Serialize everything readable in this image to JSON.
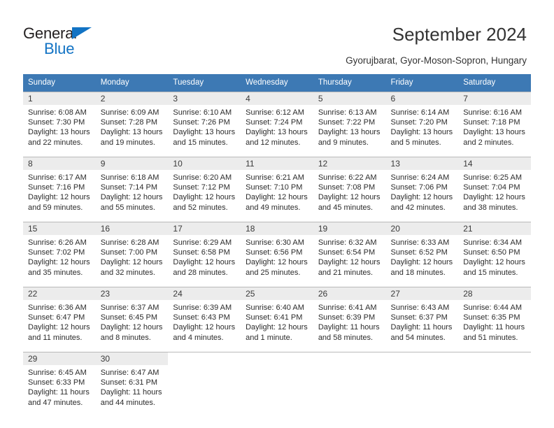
{
  "brand": {
    "name_part1": "General",
    "name_part2": "Blue",
    "logo_icon": "triangle-icon"
  },
  "header": {
    "title": "September 2024",
    "subtitle": "Gyorujbarat, Gyor-Moson-Sopron, Hungary"
  },
  "colors": {
    "header_blue": "#3d79b4",
    "brand_blue": "#1273c4",
    "day_band_gray": "#ececec",
    "grid_line": "#b9b9b9",
    "text": "#2b2b2b"
  },
  "weekday_headers": [
    "Sunday",
    "Monday",
    "Tuesday",
    "Wednesday",
    "Thursday",
    "Friday",
    "Saturday"
  ],
  "weeks": [
    [
      {
        "day": "1",
        "sunrise": "Sunrise: 6:08 AM",
        "sunset": "Sunset: 7:30 PM",
        "daylight1": "Daylight: 13 hours",
        "daylight2": "and 22 minutes."
      },
      {
        "day": "2",
        "sunrise": "Sunrise: 6:09 AM",
        "sunset": "Sunset: 7:28 PM",
        "daylight1": "Daylight: 13 hours",
        "daylight2": "and 19 minutes."
      },
      {
        "day": "3",
        "sunrise": "Sunrise: 6:10 AM",
        "sunset": "Sunset: 7:26 PM",
        "daylight1": "Daylight: 13 hours",
        "daylight2": "and 15 minutes."
      },
      {
        "day": "4",
        "sunrise": "Sunrise: 6:12 AM",
        "sunset": "Sunset: 7:24 PM",
        "daylight1": "Daylight: 13 hours",
        "daylight2": "and 12 minutes."
      },
      {
        "day": "5",
        "sunrise": "Sunrise: 6:13 AM",
        "sunset": "Sunset: 7:22 PM",
        "daylight1": "Daylight: 13 hours",
        "daylight2": "and 9 minutes."
      },
      {
        "day": "6",
        "sunrise": "Sunrise: 6:14 AM",
        "sunset": "Sunset: 7:20 PM",
        "daylight1": "Daylight: 13 hours",
        "daylight2": "and 5 minutes."
      },
      {
        "day": "7",
        "sunrise": "Sunrise: 6:16 AM",
        "sunset": "Sunset: 7:18 PM",
        "daylight1": "Daylight: 13 hours",
        "daylight2": "and 2 minutes."
      }
    ],
    [
      {
        "day": "8",
        "sunrise": "Sunrise: 6:17 AM",
        "sunset": "Sunset: 7:16 PM",
        "daylight1": "Daylight: 12 hours",
        "daylight2": "and 59 minutes."
      },
      {
        "day": "9",
        "sunrise": "Sunrise: 6:18 AM",
        "sunset": "Sunset: 7:14 PM",
        "daylight1": "Daylight: 12 hours",
        "daylight2": "and 55 minutes."
      },
      {
        "day": "10",
        "sunrise": "Sunrise: 6:20 AM",
        "sunset": "Sunset: 7:12 PM",
        "daylight1": "Daylight: 12 hours",
        "daylight2": "and 52 minutes."
      },
      {
        "day": "11",
        "sunrise": "Sunrise: 6:21 AM",
        "sunset": "Sunset: 7:10 PM",
        "daylight1": "Daylight: 12 hours",
        "daylight2": "and 49 minutes."
      },
      {
        "day": "12",
        "sunrise": "Sunrise: 6:22 AM",
        "sunset": "Sunset: 7:08 PM",
        "daylight1": "Daylight: 12 hours",
        "daylight2": "and 45 minutes."
      },
      {
        "day": "13",
        "sunrise": "Sunrise: 6:24 AM",
        "sunset": "Sunset: 7:06 PM",
        "daylight1": "Daylight: 12 hours",
        "daylight2": "and 42 minutes."
      },
      {
        "day": "14",
        "sunrise": "Sunrise: 6:25 AM",
        "sunset": "Sunset: 7:04 PM",
        "daylight1": "Daylight: 12 hours",
        "daylight2": "and 38 minutes."
      }
    ],
    [
      {
        "day": "15",
        "sunrise": "Sunrise: 6:26 AM",
        "sunset": "Sunset: 7:02 PM",
        "daylight1": "Daylight: 12 hours",
        "daylight2": "and 35 minutes."
      },
      {
        "day": "16",
        "sunrise": "Sunrise: 6:28 AM",
        "sunset": "Sunset: 7:00 PM",
        "daylight1": "Daylight: 12 hours",
        "daylight2": "and 32 minutes."
      },
      {
        "day": "17",
        "sunrise": "Sunrise: 6:29 AM",
        "sunset": "Sunset: 6:58 PM",
        "daylight1": "Daylight: 12 hours",
        "daylight2": "and 28 minutes."
      },
      {
        "day": "18",
        "sunrise": "Sunrise: 6:30 AM",
        "sunset": "Sunset: 6:56 PM",
        "daylight1": "Daylight: 12 hours",
        "daylight2": "and 25 minutes."
      },
      {
        "day": "19",
        "sunrise": "Sunrise: 6:32 AM",
        "sunset": "Sunset: 6:54 PM",
        "daylight1": "Daylight: 12 hours",
        "daylight2": "and 21 minutes."
      },
      {
        "day": "20",
        "sunrise": "Sunrise: 6:33 AM",
        "sunset": "Sunset: 6:52 PM",
        "daylight1": "Daylight: 12 hours",
        "daylight2": "and 18 minutes."
      },
      {
        "day": "21",
        "sunrise": "Sunrise: 6:34 AM",
        "sunset": "Sunset: 6:50 PM",
        "daylight1": "Daylight: 12 hours",
        "daylight2": "and 15 minutes."
      }
    ],
    [
      {
        "day": "22",
        "sunrise": "Sunrise: 6:36 AM",
        "sunset": "Sunset: 6:47 PM",
        "daylight1": "Daylight: 12 hours",
        "daylight2": "and 11 minutes."
      },
      {
        "day": "23",
        "sunrise": "Sunrise: 6:37 AM",
        "sunset": "Sunset: 6:45 PM",
        "daylight1": "Daylight: 12 hours",
        "daylight2": "and 8 minutes."
      },
      {
        "day": "24",
        "sunrise": "Sunrise: 6:39 AM",
        "sunset": "Sunset: 6:43 PM",
        "daylight1": "Daylight: 12 hours",
        "daylight2": "and 4 minutes."
      },
      {
        "day": "25",
        "sunrise": "Sunrise: 6:40 AM",
        "sunset": "Sunset: 6:41 PM",
        "daylight1": "Daylight: 12 hours",
        "daylight2": "and 1 minute."
      },
      {
        "day": "26",
        "sunrise": "Sunrise: 6:41 AM",
        "sunset": "Sunset: 6:39 PM",
        "daylight1": "Daylight: 11 hours",
        "daylight2": "and 58 minutes."
      },
      {
        "day": "27",
        "sunrise": "Sunrise: 6:43 AM",
        "sunset": "Sunset: 6:37 PM",
        "daylight1": "Daylight: 11 hours",
        "daylight2": "and 54 minutes."
      },
      {
        "day": "28",
        "sunrise": "Sunrise: 6:44 AM",
        "sunset": "Sunset: 6:35 PM",
        "daylight1": "Daylight: 11 hours",
        "daylight2": "and 51 minutes."
      }
    ],
    [
      {
        "day": "29",
        "sunrise": "Sunrise: 6:45 AM",
        "sunset": "Sunset: 6:33 PM",
        "daylight1": "Daylight: 11 hours",
        "daylight2": "and 47 minutes."
      },
      {
        "day": "30",
        "sunrise": "Sunrise: 6:47 AM",
        "sunset": "Sunset: 6:31 PM",
        "daylight1": "Daylight: 11 hours",
        "daylight2": "and 44 minutes."
      },
      {
        "day": "",
        "sunrise": "",
        "sunset": "",
        "daylight1": "",
        "daylight2": ""
      },
      {
        "day": "",
        "sunrise": "",
        "sunset": "",
        "daylight1": "",
        "daylight2": ""
      },
      {
        "day": "",
        "sunrise": "",
        "sunset": "",
        "daylight1": "",
        "daylight2": ""
      },
      {
        "day": "",
        "sunrise": "",
        "sunset": "",
        "daylight1": "",
        "daylight2": ""
      },
      {
        "day": "",
        "sunrise": "",
        "sunset": "",
        "daylight1": "",
        "daylight2": ""
      }
    ]
  ]
}
